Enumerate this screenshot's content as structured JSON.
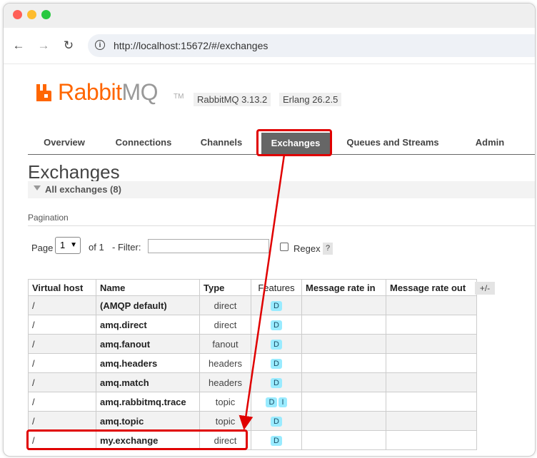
{
  "browser": {
    "url": "http://localhost:15672/#/exchanges"
  },
  "header": {
    "logo_rabbit": "Rabbit",
    "logo_mq": "MQ",
    "logo_tm": "TM",
    "rabbitmq_version": "RabbitMQ 3.13.2",
    "erlang_version": "Erlang 26.2.5"
  },
  "tabs": [
    {
      "label": "Overview"
    },
    {
      "label": "Connections"
    },
    {
      "label": "Channels"
    },
    {
      "label": "Exchanges"
    },
    {
      "label": "Queues and Streams"
    },
    {
      "label": "Admin"
    }
  ],
  "page": {
    "title": "Exchanges",
    "section_label": "All exchanges (8)",
    "pagination_label": "Pagination",
    "page_label": "Page",
    "page_value": "1",
    "of_label": "of 1",
    "filter_label": "- Filter:",
    "filter_value": "",
    "regex_label": "Regex",
    "regex_checked": false,
    "help_label": "?",
    "columns_toggle": "+/-"
  },
  "table": {
    "headers": [
      "Virtual host",
      "Name",
      "Type",
      "Features",
      "Message rate in",
      "Message rate out"
    ],
    "rows": [
      {
        "vhost": "/",
        "name": "(AMQP default)",
        "type": "direct",
        "features": [
          "D"
        ],
        "rate_in": "",
        "rate_out": ""
      },
      {
        "vhost": "/",
        "name": "amq.direct",
        "type": "direct",
        "features": [
          "D"
        ],
        "rate_in": "",
        "rate_out": ""
      },
      {
        "vhost": "/",
        "name": "amq.fanout",
        "type": "fanout",
        "features": [
          "D"
        ],
        "rate_in": "",
        "rate_out": ""
      },
      {
        "vhost": "/",
        "name": "amq.headers",
        "type": "headers",
        "features": [
          "D"
        ],
        "rate_in": "",
        "rate_out": ""
      },
      {
        "vhost": "/",
        "name": "amq.match",
        "type": "headers",
        "features": [
          "D"
        ],
        "rate_in": "",
        "rate_out": ""
      },
      {
        "vhost": "/",
        "name": "amq.rabbitmq.trace",
        "type": "topic",
        "features": [
          "D",
          "I"
        ],
        "rate_in": "",
        "rate_out": ""
      },
      {
        "vhost": "/",
        "name": "amq.topic",
        "type": "topic",
        "features": [
          "D"
        ],
        "rate_in": "",
        "rate_out": ""
      },
      {
        "vhost": "/",
        "name": "my.exchange",
        "type": "direct",
        "features": [
          "D"
        ],
        "rate_in": "",
        "rate_out": ""
      }
    ]
  },
  "colors": {
    "brand_orange": "#ff6600",
    "active_tab": "#666666",
    "highlight_red": "#e00000",
    "feature_badge": "#99ebff"
  }
}
